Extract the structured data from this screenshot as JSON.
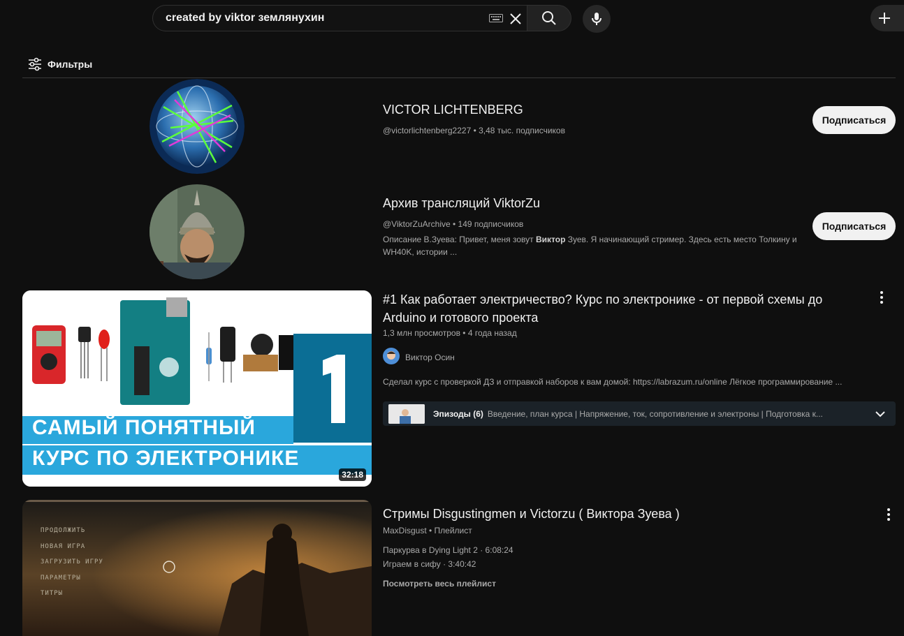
{
  "search": {
    "value": "created by viktor землянухин"
  },
  "filters": {
    "label": "Фильтры"
  },
  "channels": [
    {
      "name": "VICTOR LICHTENBERG",
      "meta": "@victorlichtenberg2227 • 3,48 тыс. подписчиков",
      "subscribe": "Подписаться"
    },
    {
      "name": "Архив трансляций ViktorZu",
      "meta": "@ViktorZuArchive • 149 подписчиков",
      "desc_1": "Описание В.Зуева: Привет, меня зовут ",
      "desc_bold": "Виктор",
      "desc_2": " Зуев. Я начинающий стример. Здесь есть место Толкину и",
      "desc_3": "WH40K, истории ...",
      "subscribe": "Подписаться"
    }
  ],
  "video": {
    "title_line1": "#1 Как работает электричество? Курс по электронике - от первой схемы до",
    "title_line2": "Arduino и готового проекта",
    "meta": "1,3 млн просмотров • 4 года назад",
    "channel": "Виктор Осин",
    "desc": "Сделал курс с проверкой ДЗ и отправкой наборов к вам домой: https://labrazum.ru/online  Лёгкое программирование ...",
    "duration": "32:18",
    "thumb_text_1": "САМЫЙ ПОНЯТНЫЙ",
    "thumb_text_2": "КУРС ПО ЭЛЕКТРОНИКЕ",
    "thumb_number": "1",
    "episodes_label": "Эпизоды (6)",
    "episodes_list": "Введение, план курса | Напряжение, ток, сопротивление и электроны | Подготовка к..."
  },
  "playlist": {
    "title": "Стримы Disgustingmen и Victorzu ( Виктора Зуева )",
    "meta": "MaxDisgust • Плейлист",
    "item1": "Паркурва в Dying Light 2 · 6:08:24",
    "item2": "Играем в сифу · 3:40:42",
    "view_all": "Посмотреть весь плейлист",
    "menu": [
      "ПРОДОЛЖИТЬ",
      "НОВАЯ ИГРА",
      "ЗАГРУЗИТЬ ИГРУ",
      "ПАРАМЕТРЫ",
      "ТИТРЫ"
    ]
  },
  "colors": {
    "background": "#0f0f0f",
    "text": "#f1f1f1",
    "secondary": "#aaaaaa",
    "subscribe_bg": "#f1f1f1",
    "thumb_blue": "#2aa7dc",
    "thumb_dark_blue": "#0b6e95"
  }
}
